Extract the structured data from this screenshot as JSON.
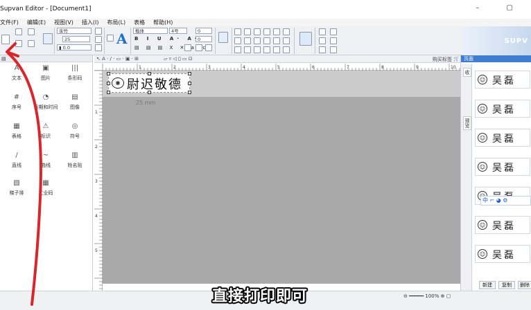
{
  "app": {
    "title": "Supvan Editor - [Document1]",
    "brand": "SUPV"
  },
  "menu": [
    "文件(F)",
    "编辑(E)",
    "视图(V)",
    "插入(I)",
    "布局(L)",
    "表格",
    "帮助(H)"
  ],
  "ribbon": {
    "font_family": "楷体",
    "font_size": "4号",
    "angle": "0",
    "spacing": "0",
    "dropdown_value": "25",
    "style_buttons": [
      "B",
      "I",
      "U",
      "A",
      "X",
      "abc"
    ]
  },
  "left_panel": {
    "header": " ",
    "tools": [
      {
        "label": "文本",
        "icon": "A"
      },
      {
        "label": "图片",
        "icon": "▣"
      },
      {
        "label": "条形码",
        "icon": "|||"
      },
      {
        "label": "序号",
        "icon": "#"
      },
      {
        "label": "日期和时间",
        "icon": "◔"
      },
      {
        "label": "图像",
        "icon": "▤"
      },
      {
        "label": "表格",
        "icon": "▦"
      },
      {
        "label": "标识",
        "icon": "⚠"
      },
      {
        "label": "符号",
        "icon": "◎"
      },
      {
        "label": "直线",
        "icon": "/"
      },
      {
        "label": "曲线",
        "icon": "~"
      },
      {
        "label": "姓名贴",
        "icon": "▥"
      },
      {
        "label": "梯子排",
        "icon": "▧"
      },
      {
        "label": "工业码",
        "icon": "▦"
      }
    ]
  },
  "canvas": {
    "ruler_h": [
      "1",
      "2",
      "3",
      "4",
      "5",
      "6",
      "7",
      "8",
      "9",
      "10"
    ],
    "ruler_v": [
      "1",
      "2",
      "3",
      "4",
      "5"
    ],
    "label_text": "尉迟敬德",
    "dimension": "25 mm",
    "purchase_label": "购买标签"
  },
  "right_panel": {
    "header": "页面",
    "tabs": [
      "收",
      "预览"
    ],
    "template_name": "吴磊",
    "ime": "中 ⌐ ◕ ⚙",
    "buttons": [
      "新建",
      "复制",
      "删除"
    ]
  },
  "status": {
    "zoom": "100%"
  },
  "caption": "直接打印即可",
  "colors": {
    "arrow": "#d8262b",
    "header_blue": "#3f7dd0",
    "workspace": "#a9a9a9"
  }
}
